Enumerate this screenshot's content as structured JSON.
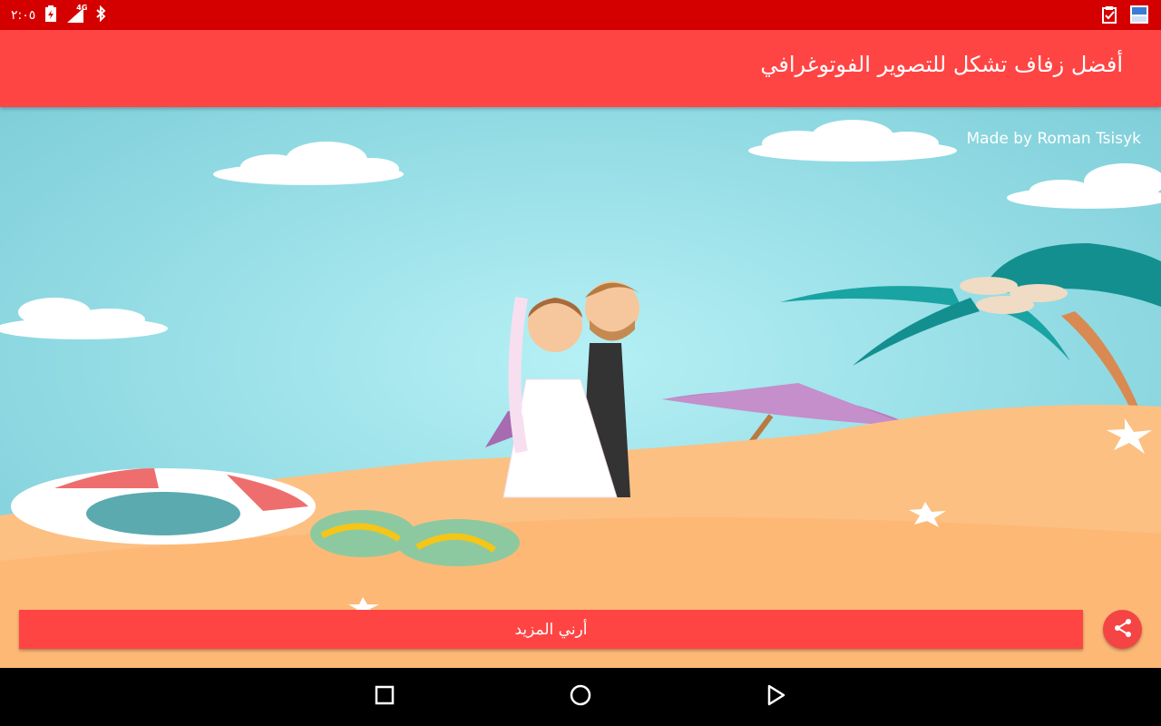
{
  "status_bar": {
    "time": "٢:٠٥",
    "network": "4G",
    "icons": [
      "battery-charging-icon",
      "signal-icon",
      "bluetooth-icon",
      "clipboard-check-icon",
      "app-notification-icon"
    ]
  },
  "app_bar": {
    "title": "أفضل زفاف تشكل للتصوير الفوتوغرافي"
  },
  "scene": {
    "credit": "Made by Roman Tsisyk"
  },
  "actions": {
    "more_label": "أرني المزيد",
    "share_icon": "share-icon"
  },
  "nav_bar": {
    "icons": [
      "recents-square-icon",
      "home-circle-icon",
      "back-triangle-icon"
    ]
  },
  "colors": {
    "status_bar": "#d40000",
    "app_bar": "#ff4444",
    "sky": "#8fd8e0",
    "sand": "#fcc083"
  }
}
